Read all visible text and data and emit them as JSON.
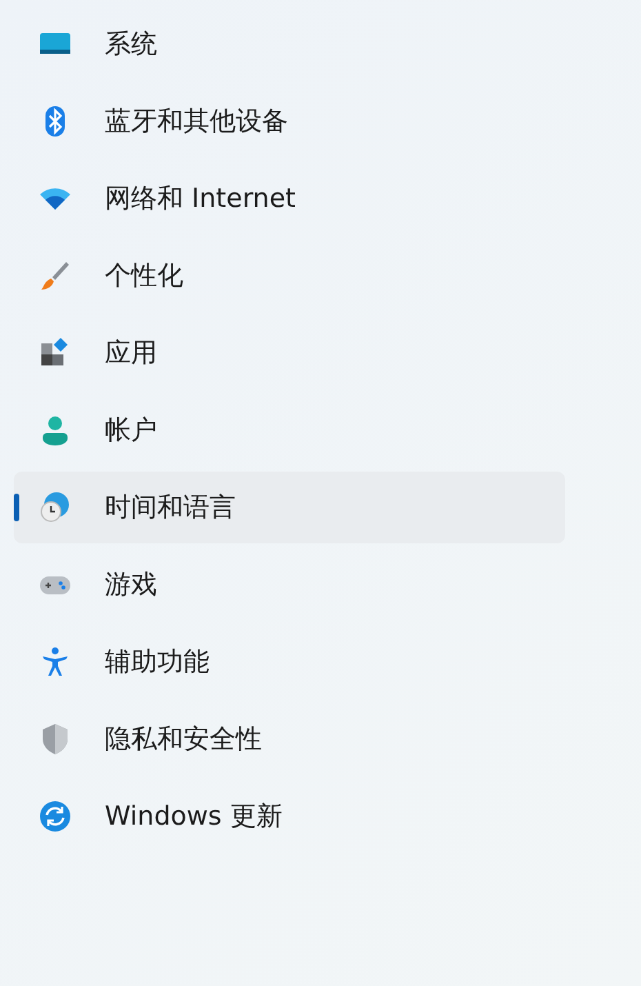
{
  "sidebar": {
    "items": [
      {
        "label": "系统",
        "selected": false
      },
      {
        "label": "蓝牙和其他设备",
        "selected": false
      },
      {
        "label": "网络和 Internet",
        "selected": false
      },
      {
        "label": "个性化",
        "selected": false
      },
      {
        "label": "应用",
        "selected": false
      },
      {
        "label": "帐户",
        "selected": false
      },
      {
        "label": "时间和语言",
        "selected": true
      },
      {
        "label": "游戏",
        "selected": false
      },
      {
        "label": "辅助功能",
        "selected": false
      },
      {
        "label": "隐私和安全性",
        "selected": false
      },
      {
        "label": "Windows 更新",
        "selected": false
      }
    ]
  }
}
